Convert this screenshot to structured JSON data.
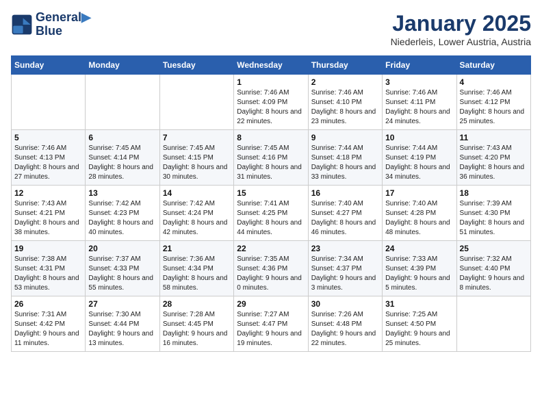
{
  "logo": {
    "line1": "General",
    "line2": "Blue"
  },
  "title": "January 2025",
  "subtitle": "Niederleis, Lower Austria, Austria",
  "days_of_week": [
    "Sunday",
    "Monday",
    "Tuesday",
    "Wednesday",
    "Thursday",
    "Friday",
    "Saturday"
  ],
  "weeks": [
    [
      {
        "num": "",
        "info": ""
      },
      {
        "num": "",
        "info": ""
      },
      {
        "num": "",
        "info": ""
      },
      {
        "num": "1",
        "info": "Sunrise: 7:46 AM\nSunset: 4:09 PM\nDaylight: 8 hours and 22 minutes."
      },
      {
        "num": "2",
        "info": "Sunrise: 7:46 AM\nSunset: 4:10 PM\nDaylight: 8 hours and 23 minutes."
      },
      {
        "num": "3",
        "info": "Sunrise: 7:46 AM\nSunset: 4:11 PM\nDaylight: 8 hours and 24 minutes."
      },
      {
        "num": "4",
        "info": "Sunrise: 7:46 AM\nSunset: 4:12 PM\nDaylight: 8 hours and 25 minutes."
      }
    ],
    [
      {
        "num": "5",
        "info": "Sunrise: 7:46 AM\nSunset: 4:13 PM\nDaylight: 8 hours and 27 minutes."
      },
      {
        "num": "6",
        "info": "Sunrise: 7:45 AM\nSunset: 4:14 PM\nDaylight: 8 hours and 28 minutes."
      },
      {
        "num": "7",
        "info": "Sunrise: 7:45 AM\nSunset: 4:15 PM\nDaylight: 8 hours and 30 minutes."
      },
      {
        "num": "8",
        "info": "Sunrise: 7:45 AM\nSunset: 4:16 PM\nDaylight: 8 hours and 31 minutes."
      },
      {
        "num": "9",
        "info": "Sunrise: 7:44 AM\nSunset: 4:18 PM\nDaylight: 8 hours and 33 minutes."
      },
      {
        "num": "10",
        "info": "Sunrise: 7:44 AM\nSunset: 4:19 PM\nDaylight: 8 hours and 34 minutes."
      },
      {
        "num": "11",
        "info": "Sunrise: 7:43 AM\nSunset: 4:20 PM\nDaylight: 8 hours and 36 minutes."
      }
    ],
    [
      {
        "num": "12",
        "info": "Sunrise: 7:43 AM\nSunset: 4:21 PM\nDaylight: 8 hours and 38 minutes."
      },
      {
        "num": "13",
        "info": "Sunrise: 7:42 AM\nSunset: 4:23 PM\nDaylight: 8 hours and 40 minutes."
      },
      {
        "num": "14",
        "info": "Sunrise: 7:42 AM\nSunset: 4:24 PM\nDaylight: 8 hours and 42 minutes."
      },
      {
        "num": "15",
        "info": "Sunrise: 7:41 AM\nSunset: 4:25 PM\nDaylight: 8 hours and 44 minutes."
      },
      {
        "num": "16",
        "info": "Sunrise: 7:40 AM\nSunset: 4:27 PM\nDaylight: 8 hours and 46 minutes."
      },
      {
        "num": "17",
        "info": "Sunrise: 7:40 AM\nSunset: 4:28 PM\nDaylight: 8 hours and 48 minutes."
      },
      {
        "num": "18",
        "info": "Sunrise: 7:39 AM\nSunset: 4:30 PM\nDaylight: 8 hours and 51 minutes."
      }
    ],
    [
      {
        "num": "19",
        "info": "Sunrise: 7:38 AM\nSunset: 4:31 PM\nDaylight: 8 hours and 53 minutes."
      },
      {
        "num": "20",
        "info": "Sunrise: 7:37 AM\nSunset: 4:33 PM\nDaylight: 8 hours and 55 minutes."
      },
      {
        "num": "21",
        "info": "Sunrise: 7:36 AM\nSunset: 4:34 PM\nDaylight: 8 hours and 58 minutes."
      },
      {
        "num": "22",
        "info": "Sunrise: 7:35 AM\nSunset: 4:36 PM\nDaylight: 9 hours and 0 minutes."
      },
      {
        "num": "23",
        "info": "Sunrise: 7:34 AM\nSunset: 4:37 PM\nDaylight: 9 hours and 3 minutes."
      },
      {
        "num": "24",
        "info": "Sunrise: 7:33 AM\nSunset: 4:39 PM\nDaylight: 9 hours and 5 minutes."
      },
      {
        "num": "25",
        "info": "Sunrise: 7:32 AM\nSunset: 4:40 PM\nDaylight: 9 hours and 8 minutes."
      }
    ],
    [
      {
        "num": "26",
        "info": "Sunrise: 7:31 AM\nSunset: 4:42 PM\nDaylight: 9 hours and 11 minutes."
      },
      {
        "num": "27",
        "info": "Sunrise: 7:30 AM\nSunset: 4:44 PM\nDaylight: 9 hours and 13 minutes."
      },
      {
        "num": "28",
        "info": "Sunrise: 7:28 AM\nSunset: 4:45 PM\nDaylight: 9 hours and 16 minutes."
      },
      {
        "num": "29",
        "info": "Sunrise: 7:27 AM\nSunset: 4:47 PM\nDaylight: 9 hours and 19 minutes."
      },
      {
        "num": "30",
        "info": "Sunrise: 7:26 AM\nSunset: 4:48 PM\nDaylight: 9 hours and 22 minutes."
      },
      {
        "num": "31",
        "info": "Sunrise: 7:25 AM\nSunset: 4:50 PM\nDaylight: 9 hours and 25 minutes."
      },
      {
        "num": "",
        "info": ""
      }
    ]
  ]
}
